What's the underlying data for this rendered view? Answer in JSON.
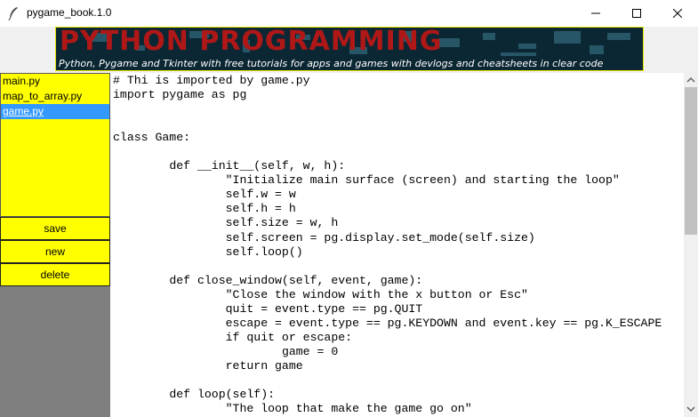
{
  "window": {
    "title": "pygame_book.1.0",
    "icon": "feather-icon",
    "controls": [
      "minimize-icon",
      "maximize-icon",
      "close-icon"
    ]
  },
  "banner": {
    "title": "PYTHON PROGRAMMING",
    "subtitle": "Python, Pygame and Tkinter with free tutorials for apps and games with devlogs and cheatsheets in clear code",
    "title_color": "#b01818",
    "border_color": "#e8e800"
  },
  "sidebar": {
    "files": [
      "main.py",
      "map_to_array.py",
      "game.py"
    ],
    "selected": "game.py",
    "list_color": "#ffff00",
    "selection_color": "#3399ff",
    "buttons": {
      "save": "save",
      "new": "new",
      "delete": "delete"
    }
  },
  "editor": {
    "code": "# Thi is imported by game.py\nimport pygame as pg\n\n\nclass Game:\n\n\tdef __init__(self, w, h):\n\t\t\"Initialize main surface (screen) and starting the loop\"\n\t\tself.w = w\n\t\tself.h = h\n\t\tself.size = w, h\n\t\tself.screen = pg.display.set_mode(self.size)\n\t\tself.loop()\n\n\tdef close_window(self, event, game):\n\t\t\"Close the window with the x button or Esc\"\n\t\tquit = event.type == pg.QUIT\n\t\tescape = event.type == pg.KEYDOWN and event.key == pg.K_ESCAPE\n\t\tif quit or escape:\n\t\t\tgame = 0\n\t\treturn game\n\n\tdef loop(self):\n\t\t\"The loop that make the game go on\""
  }
}
